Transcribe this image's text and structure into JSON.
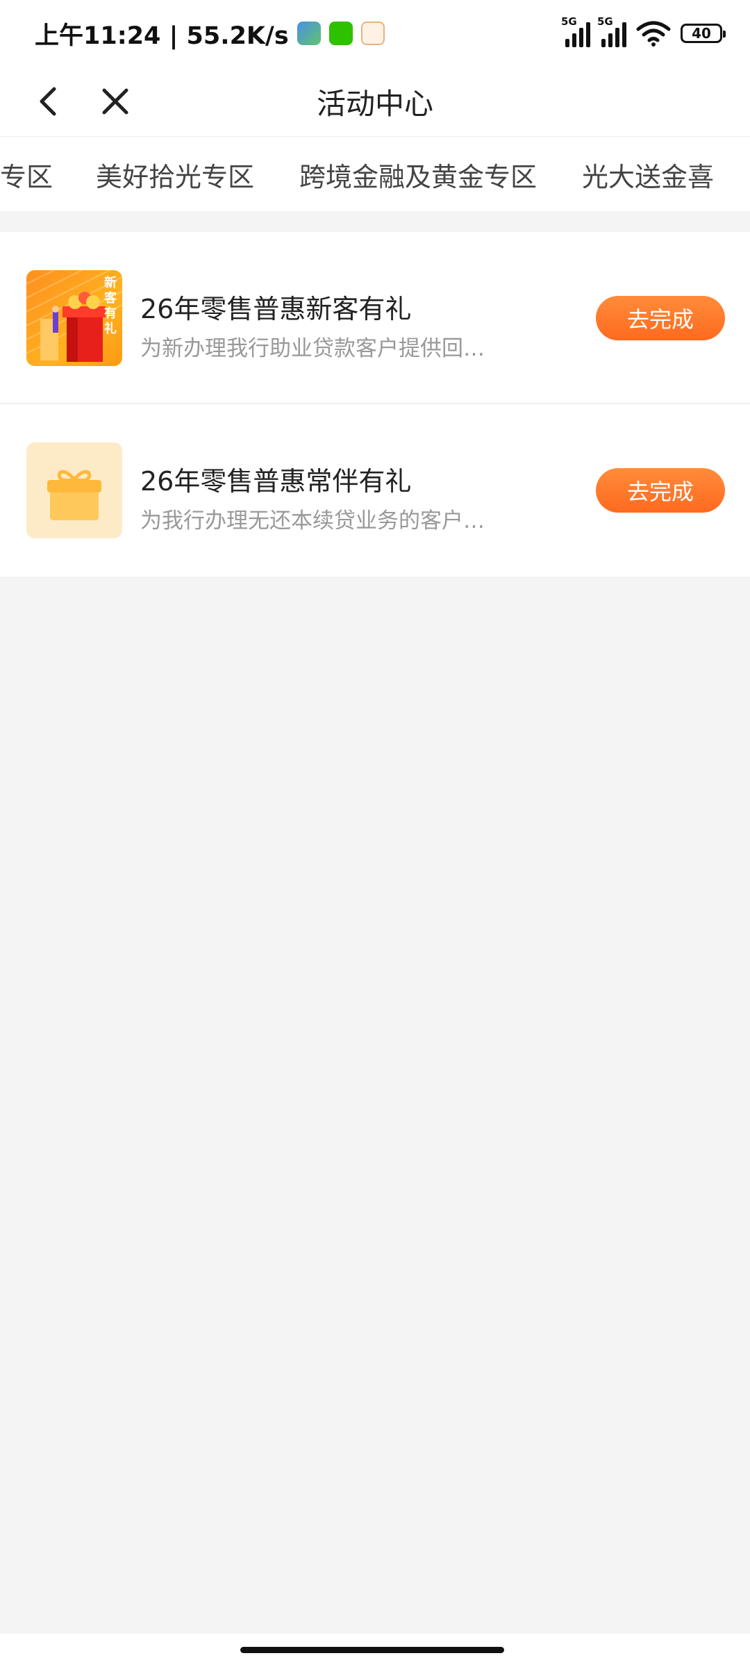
{
  "status_bar": {
    "time": "上午11:24 | 55.2K/s",
    "network_left": "5G",
    "network_right": "5G",
    "battery": "40"
  },
  "nav": {
    "title": "活动中心",
    "back_icon": "chevron-left-icon",
    "close_icon": "close-icon"
  },
  "tabs": [
    {
      "label": "专区"
    },
    {
      "label": "美好拾光专区"
    },
    {
      "label": "跨境金融及黄金专区"
    },
    {
      "label": "光大送金喜"
    }
  ],
  "activities": [
    {
      "title": "26年零售普惠新客有礼",
      "description": "为新办理我行助业贷款客户提供回…",
      "thumb_text": "新客有礼",
      "action": "去完成"
    },
    {
      "title": "26年零售普惠常伴有礼",
      "description": "为我行办理无还本续贷业务的客户…",
      "action": "去完成"
    }
  ],
  "colors": {
    "accent": "#ff6a1f",
    "page_bg": "#f4f4f4"
  }
}
